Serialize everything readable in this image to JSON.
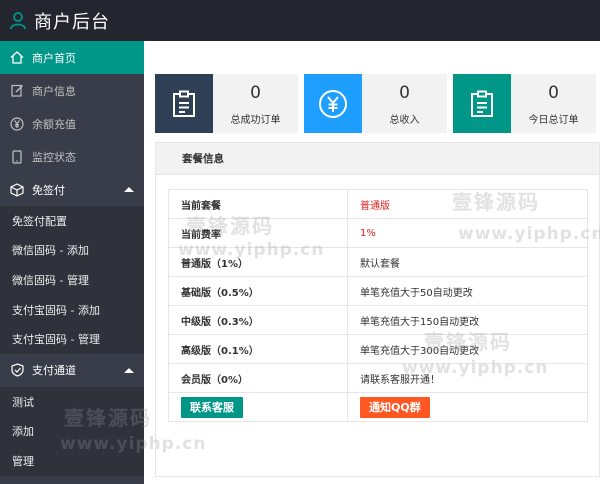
{
  "header": {
    "title": "商户后台",
    "icon": "user-icon"
  },
  "sidebar": {
    "items": [
      {
        "label": "商户首页",
        "icon": "home-icon",
        "active": true
      },
      {
        "label": "商户信息",
        "icon": "edit-icon"
      },
      {
        "label": "余额充值",
        "icon": "yen-circle-icon"
      },
      {
        "label": "监控状态",
        "icon": "phone-icon"
      }
    ],
    "groups": [
      {
        "label": "免签付",
        "icon": "cube-icon",
        "items": [
          "免签付配置",
          "微信固码 - 添加",
          "微信固码 - 管理",
          "支付宝固码 - 添加",
          "支付宝固码 - 管理"
        ]
      },
      {
        "label": "支付通道",
        "icon": "shield-icon",
        "items": [
          "测试",
          "添加",
          "管理"
        ]
      }
    ]
  },
  "cards": [
    {
      "value": "0",
      "label": "总成功订单",
      "color": "#2f4056",
      "icon": "clipboard-icon"
    },
    {
      "value": "0",
      "label": "总收入",
      "color": "#1e9fff",
      "icon": "yen-icon"
    },
    {
      "value": "0",
      "label": "今日总订单",
      "color": "#009688",
      "icon": "clipboard-icon"
    }
  ],
  "panel": {
    "title": "套餐信息",
    "rows": [
      {
        "k": "当前套餐",
        "v": "普通版",
        "red": true
      },
      {
        "k": "当前费率",
        "v": "1%",
        "red": true
      },
      {
        "k": "普通版（1%）",
        "v": "默认套餐"
      },
      {
        "k": "基础版（0.5%）",
        "v": "单笔充值大于50自动更改"
      },
      {
        "k": "中级版（0.3%）",
        "v": "单笔充值大于150自动更改"
      },
      {
        "k": "高级版（0.1%）",
        "v": "单笔充值大于300自动更改"
      },
      {
        "k": "会员版（0%）",
        "v": "请联系客服开通！"
      }
    ],
    "btn_service": "联系客服",
    "btn_qq": "通知QQ群"
  },
  "watermarks": {
    "cn": "壹锋源码",
    "en": "www.yiphp.cn"
  },
  "colors": {
    "teal": "#009688",
    "orange": "#ff5722",
    "red": "#e2211c",
    "sidebar_bg": "#393d49",
    "header_bg": "#23262e"
  }
}
